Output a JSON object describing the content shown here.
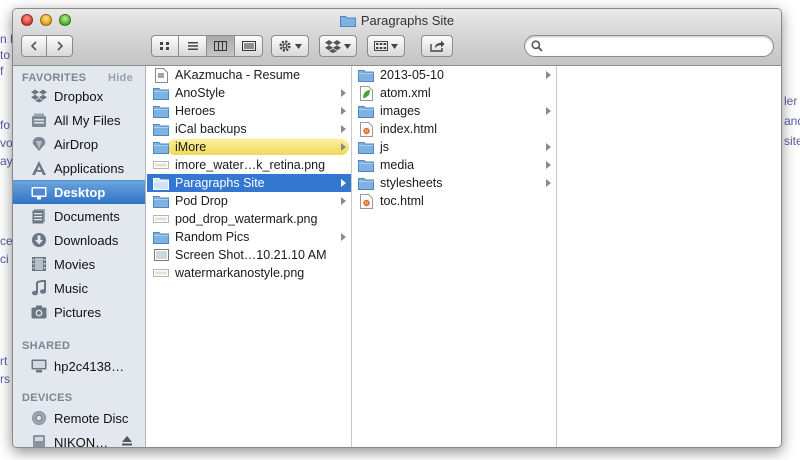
{
  "background_fragments": [
    "n F",
    "to",
    "f",
    "fo",
    "vo",
    "ay",
    "ce",
    "ci",
    "ler",
    "and",
    "site",
    "rt",
    "rs"
  ],
  "window": {
    "title": "Paragraphs Site",
    "folder_icon": "folder-icon"
  },
  "toolbar": {
    "back_icon": "chevron-left-icon",
    "forward_icon": "chevron-right-icon",
    "view_modes": [
      "icon-view",
      "list-view",
      "column-view",
      "cover-flow-view"
    ],
    "active_view": "column-view",
    "action_icon": "gear-icon",
    "dropbox_icon": "dropbox-icon",
    "arrange_icon": "arrange-icon",
    "share_icon": "share-icon",
    "search": {
      "value": "",
      "placeholder": ""
    }
  },
  "sidebar": {
    "favorites_header": "FAVORITES",
    "hide_label": "Hide",
    "favorites": [
      {
        "label": "Dropbox",
        "icon": "dropbox-icon"
      },
      {
        "label": "All My Files",
        "icon": "all-files-icon"
      },
      {
        "label": "AirDrop",
        "icon": "airdrop-icon"
      },
      {
        "label": "Applications",
        "icon": "applications-icon"
      },
      {
        "label": "Desktop",
        "icon": "desktop-icon",
        "selected": true
      },
      {
        "label": "Documents",
        "icon": "documents-icon"
      },
      {
        "label": "Downloads",
        "icon": "downloads-icon"
      },
      {
        "label": "Movies",
        "icon": "movies-icon"
      },
      {
        "label": "Music",
        "icon": "music-icon"
      },
      {
        "label": "Pictures",
        "icon": "pictures-icon"
      }
    ],
    "shared_header": "SHARED",
    "shared": [
      {
        "label": "hp2c4138…",
        "icon": "display-icon"
      }
    ],
    "devices_header": "DEVICES",
    "devices": [
      {
        "label": "Remote Disc",
        "icon": "disc-icon"
      },
      {
        "label": "NIKON…",
        "icon": "drive-icon",
        "eject_icon": "eject-icon"
      }
    ]
  },
  "column1": [
    {
      "label": "AKazmucha - Resume",
      "icon": "document-icon",
      "chevron": false
    },
    {
      "label": "AnoStyle",
      "icon": "folder-icon",
      "chevron": true
    },
    {
      "label": "Heroes",
      "icon": "folder-icon",
      "chevron": true
    },
    {
      "label": "iCal backups",
      "icon": "folder-icon",
      "chevron": true
    },
    {
      "label": "iMore",
      "icon": "folder-icon",
      "chevron": true,
      "tag": "yellow"
    },
    {
      "label": "imore_water…k_retina.png",
      "icon": "image-file-icon",
      "chevron": false
    },
    {
      "label": "Paragraphs Site",
      "icon": "folder-icon",
      "chevron": true,
      "selected": true
    },
    {
      "label": "Pod Drop",
      "icon": "folder-icon",
      "chevron": true
    },
    {
      "label": "pod_drop_watermark.png",
      "icon": "image-file-icon",
      "chevron": false
    },
    {
      "label": "Random Pics",
      "icon": "folder-icon",
      "chevron": true
    },
    {
      "label": "Screen Shot…10.21.10 AM",
      "icon": "screenshot-file-icon",
      "chevron": false
    },
    {
      "label": "watermarkanostyle.png",
      "icon": "image-file-icon",
      "chevron": false
    }
  ],
  "column2": [
    {
      "label": "2013-05-10",
      "icon": "folder-icon",
      "chevron": true
    },
    {
      "label": "atom.xml",
      "icon": "xml-file-icon",
      "chevron": false
    },
    {
      "label": "images",
      "icon": "folder-icon",
      "chevron": true
    },
    {
      "label": "index.html",
      "icon": "html-file-icon",
      "chevron": false
    },
    {
      "label": "js",
      "icon": "folder-icon",
      "chevron": true
    },
    {
      "label": "media",
      "icon": "folder-icon",
      "chevron": true
    },
    {
      "label": "stylesheets",
      "icon": "folder-icon",
      "chevron": true
    },
    {
      "label": "toc.html",
      "icon": "html-file-icon",
      "chevron": false
    }
  ],
  "colors": {
    "selection": "#3477d0",
    "sidebar_bg": "#e3e8ee",
    "folder": "#6ea9dc",
    "tag_yellow": "#f1d85a"
  }
}
